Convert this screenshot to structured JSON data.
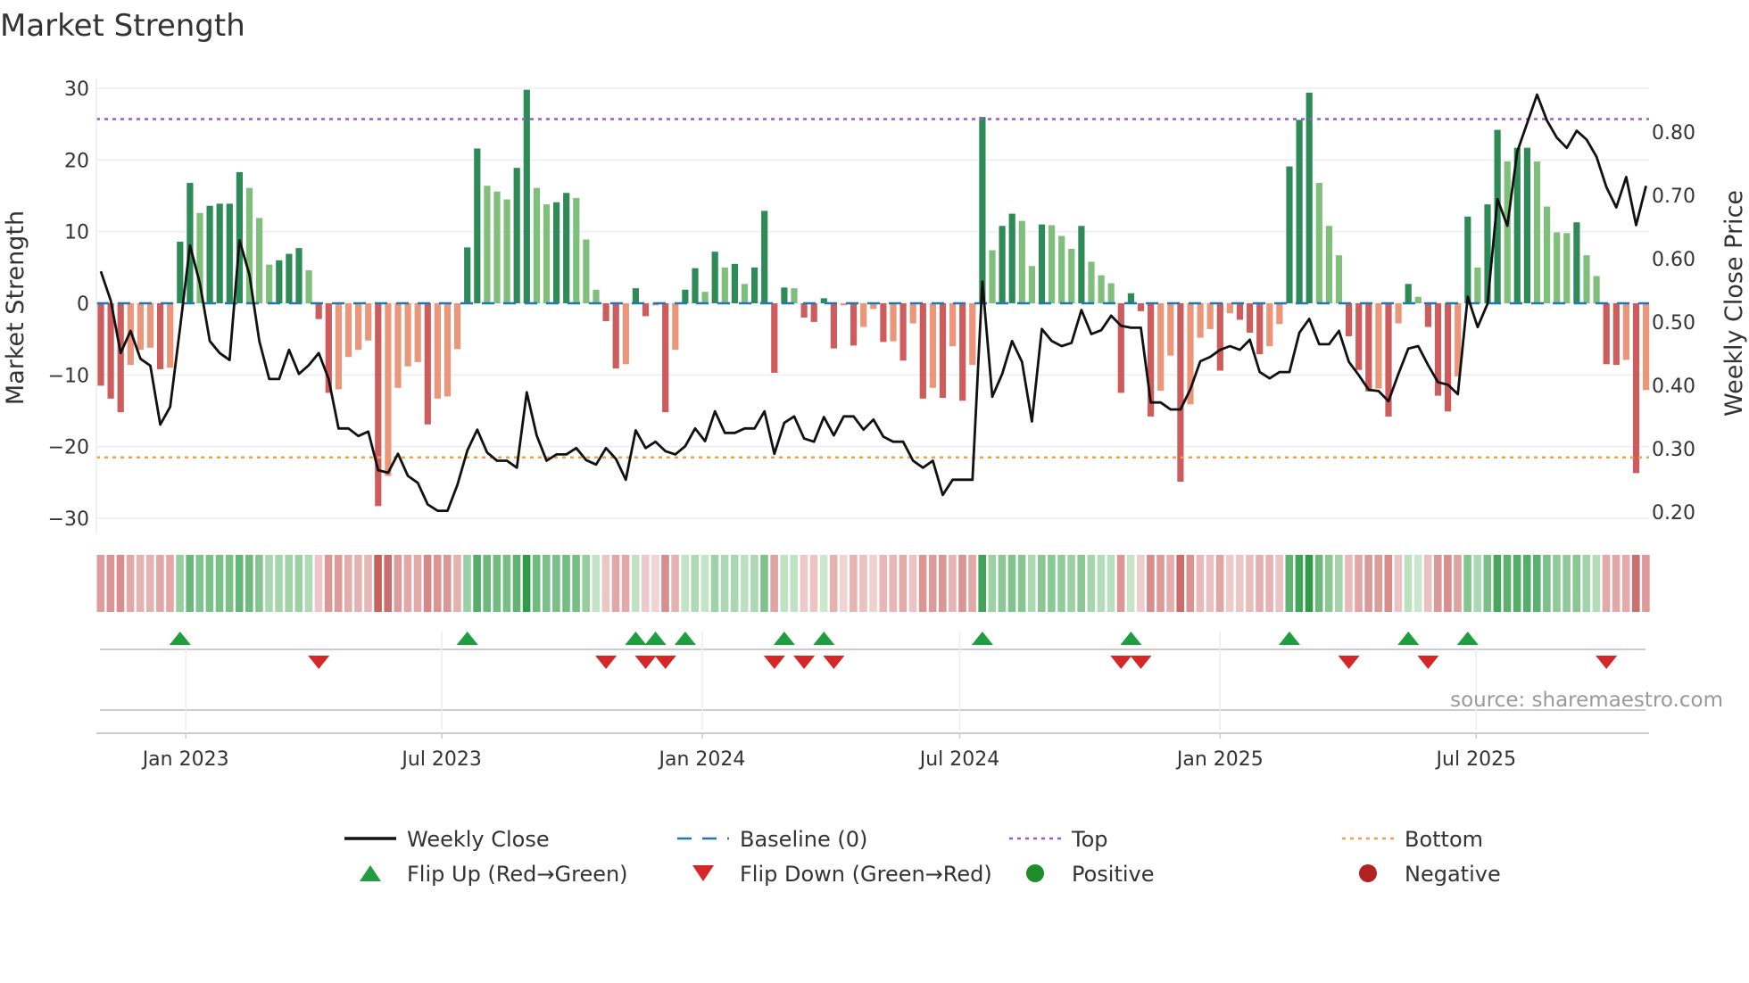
{
  "chart_data": {
    "type": "bar",
    "title": "Market Strength",
    "ylabel": "Market Strength",
    "y2label": "Weekly Close Price",
    "ylim": [
      -32,
      32
    ],
    "y2lim": [
      0.18,
      0.88
    ],
    "yticks": [
      30,
      20,
      10,
      0,
      -10,
      -20,
      -30
    ],
    "ytick_labels": [
      "30",
      "20",
      "10",
      "0",
      "−10",
      "−20",
      "−30"
    ],
    "y2ticks": [
      0.8,
      0.7,
      0.6,
      0.5,
      0.4,
      0.3,
      0.2
    ],
    "y2tick_labels": [
      "0.80",
      "0.70",
      "0.60",
      "0.50",
      "0.40",
      "0.30",
      "0.20"
    ],
    "start_date": "2022-11-02",
    "frequency": "weekly",
    "xticks": [
      {
        "date": "2023-01-01",
        "label": "Jan 2023"
      },
      {
        "date": "2023-07-01",
        "label": "Jul 2023"
      },
      {
        "date": "2024-01-01",
        "label": "Jan 2024"
      },
      {
        "date": "2024-07-01",
        "label": "Jul 2024"
      },
      {
        "date": "2025-01-01",
        "label": "Jan 2025"
      },
      {
        "date": "2025-07-01",
        "label": "Jul 2025"
      }
    ],
    "top_level": 25.7,
    "bottom_level": -21.5,
    "strength": [
      -11.5,
      -13.3,
      -15.2,
      -8.6,
      -6.5,
      -6.2,
      -9.2,
      -9.0,
      8.6,
      16.8,
      12.6,
      13.6,
      13.9,
      13.9,
      18.3,
      16.1,
      11.9,
      5.4,
      6.0,
      6.9,
      7.7,
      4.6,
      -2.2,
      -12.5,
      -12.0,
      -7.5,
      -6.5,
      -5.2,
      -28.3,
      -24.1,
      -11.8,
      -8.8,
      -8.2,
      -16.9,
      -13.3,
      -13.0,
      -6.4,
      7.8,
      21.6,
      16.4,
      15.6,
      14.5,
      18.9,
      29.8,
      16.1,
      13.8,
      14.1,
      15.4,
      14.7,
      8.9,
      1.9,
      -2.5,
      -9.1,
      -8.5,
      2.1,
      -1.8,
      -0.3,
      -15.2,
      -6.5,
      1.9,
      4.9,
      1.6,
      7.2,
      5.0,
      5.5,
      2.7,
      5.0,
      12.9,
      -9.7,
      2.2,
      2.1,
      -2.0,
      -2.6,
      0.7,
      -6.3,
      -0.3,
      -5.9,
      -3.3,
      -0.8,
      -5.4,
      -5.3,
      -8.0,
      -2.8,
      -13.3,
      -11.8,
      -13.2,
      -6.0,
      -13.6,
      -8.6,
      26.0,
      7.4,
      10.8,
      12.5,
      11.5,
      5.2,
      11.0,
      10.9,
      9.4,
      7.6,
      10.8,
      5.8,
      3.9,
      2.8,
      -12.5,
      1.4,
      -1.1,
      -15.8,
      -12.2,
      -7.3,
      -24.9,
      -14.1,
      -4.8,
      -3.6,
      -9.4,
      -1.4,
      -2.3,
      -4.1,
      -7.1,
      -6.0,
      -2.9,
      19.1,
      25.6,
      29.4,
      16.8,
      10.8,
      6.7,
      -4.6,
      -9.3,
      -12.3,
      -11.9,
      -15.8,
      -2.8,
      2.7,
      0.9,
      -3.3,
      -12.9,
      -15.1,
      -10.2,
      12.1,
      5.0,
      13.8,
      24.2,
      19.8,
      21.7,
      21.7,
      19.8,
      13.5,
      9.9,
      9.8,
      11.3,
      6.7,
      3.8,
      -8.5,
      -8.6,
      -7.9,
      -23.7,
      -12.1
    ],
    "weekly_close": [
      0.58,
      0.534,
      0.451,
      0.486,
      0.442,
      0.431,
      0.338,
      0.366,
      0.491,
      0.621,
      0.561,
      0.47,
      0.451,
      0.44,
      0.629,
      0.575,
      0.47,
      0.41,
      0.41,
      0.456,
      0.418,
      0.432,
      0.451,
      0.41,
      0.332,
      0.332,
      0.32,
      0.327,
      0.266,
      0.262,
      0.292,
      0.257,
      0.246,
      0.212,
      0.202,
      0.202,
      0.243,
      0.297,
      0.33,
      0.294,
      0.281,
      0.281,
      0.27,
      0.389,
      0.321,
      0.281,
      0.291,
      0.291,
      0.301,
      0.282,
      0.275,
      0.301,
      0.284,
      0.251,
      0.329,
      0.301,
      0.311,
      0.296,
      0.291,
      0.304,
      0.332,
      0.312,
      0.359,
      0.325,
      0.325,
      0.332,
      0.332,
      0.359,
      0.292,
      0.341,
      0.351,
      0.316,
      0.311,
      0.35,
      0.321,
      0.351,
      0.351,
      0.33,
      0.346,
      0.319,
      0.311,
      0.311,
      0.281,
      0.27,
      0.281,
      0.227,
      0.251,
      0.251,
      0.251,
      0.564,
      0.382,
      0.418,
      0.47,
      0.437,
      0.343,
      0.489,
      0.47,
      0.462,
      0.467,
      0.519,
      0.481,
      0.487,
      0.51,
      0.494,
      0.491,
      0.491,
      0.373,
      0.373,
      0.362,
      0.362,
      0.394,
      0.438,
      0.445,
      0.456,
      0.462,
      0.456,
      0.472,
      0.421,
      0.411,
      0.421,
      0.421,
      0.483,
      0.505,
      0.465,
      0.465,
      0.486,
      0.437,
      0.416,
      0.393,
      0.391,
      0.375,
      0.418,
      0.458,
      0.462,
      0.432,
      0.405,
      0.401,
      0.386,
      0.54,
      0.492,
      0.529,
      0.694,
      0.652,
      0.769,
      0.814,
      0.859,
      0.818,
      0.791,
      0.775,
      0.802,
      0.788,
      0.761,
      0.713,
      0.681,
      0.729,
      0.653,
      0.715
    ],
    "flip_up_weeks": [
      8,
      37,
      54,
      56,
      59,
      69,
      73,
      89,
      104,
      120,
      132,
      138
    ],
    "flip_down_weeks": [
      22,
      51,
      55,
      57,
      68,
      71,
      74,
      103,
      105,
      126,
      134,
      152
    ],
    "legend": [
      {
        "label": "Weekly Close",
        "kind": "line",
        "color": "#111111"
      },
      {
        "label": "Baseline (0)",
        "kind": "dash",
        "color": "#1f77b4"
      },
      {
        "label": "Top",
        "kind": "dot",
        "color": "#9b59d0"
      },
      {
        "label": "Bottom",
        "kind": "dot",
        "color": "#f0a050"
      },
      {
        "label": "Flip Up (Red→Green)",
        "kind": "tri-up",
        "color": "#1e9e3e"
      },
      {
        "label": "Flip Down (Green→Red)",
        "kind": "tri-down",
        "color": "#d62728"
      },
      {
        "label": "Positive",
        "kind": "circle",
        "color": "#1e8c2a"
      },
      {
        "label": "Negative",
        "kind": "circle",
        "color": "#b22222"
      }
    ],
    "legend_placement": "bottom",
    "colors": {
      "pos_strong": "#2e8b57",
      "pos_weak": "#7fbf7b",
      "neg_strong": "#cd5c5c",
      "neg_weak": "#e9967a"
    },
    "source": "source: sharemaestro.com"
  }
}
